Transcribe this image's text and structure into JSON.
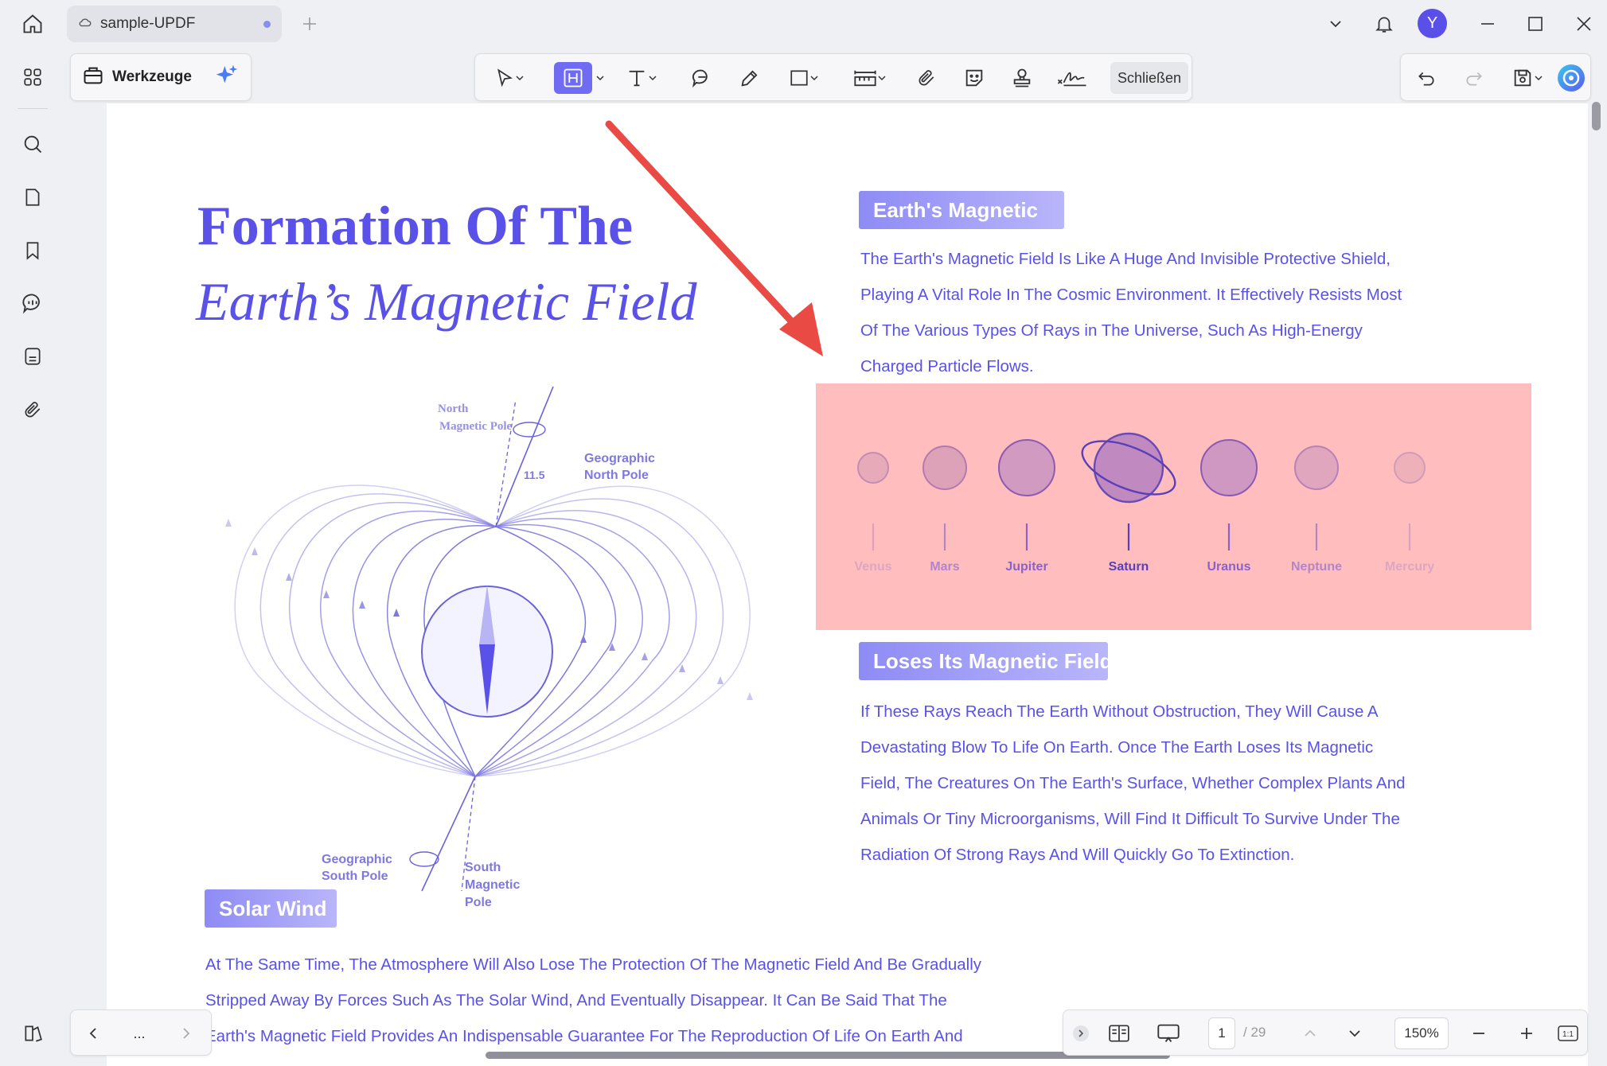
{
  "tab": {
    "title": "sample-UPDF"
  },
  "user": {
    "initial": "Y"
  },
  "toolbar": {
    "tools_label": "Werkzeuge",
    "close_label": "Schließen"
  },
  "document": {
    "title_line1": "Formation Of The",
    "title_line2": "Earth’s Magnetic Field",
    "section1": {
      "heading": "Earth's Magnetic",
      "lines": [
        "The Earth's Magnetic Field Is Like A Huge And Invisible Protective Shield,",
        "Playing A Vital Role In The Cosmic Environment. It Effectively Resists Most",
        "Of The Various Types Of Rays in The Universe, Such As High-Energy",
        "Charged Particle Flows."
      ]
    },
    "section2": {
      "heading": "Loses Its Magnetic Field",
      "lines": [
        "If These Rays Reach The Earth Without Obstruction, They Will Cause A",
        "Devastating Blow To Life On Earth. Once The Earth Loses Its Magnetic",
        "Field, The Creatures On The Earth's Surface, Whether Complex Plants And",
        "Animals Or Tiny Microorganisms, Will Find It Difficult To Survive Under The",
        "Radiation Of Strong Rays And Will Quickly Go To Extinction."
      ]
    },
    "section3": {
      "heading": "Solar Wind",
      "lines": [
        "At The Same Time, The Atmosphere Will Also Lose The Protection Of The Magnetic Field And Be Gradually",
        "Stripped Away By Forces Such As The Solar Wind, And Eventually Disappear. It Can Be Said That The",
        "Earth's Magnetic Field Provides An Indispensable Guarantee For The Reproduction Of Life On Earth And"
      ]
    },
    "diagram": {
      "north_magnetic": [
        "North",
        "Magnetic Pole"
      ],
      "geo_north": [
        "Geographic",
        "North Pole"
      ],
      "geo_south": [
        "Geographic",
        "South Pole"
      ],
      "south_magnetic": [
        "South",
        "Magnetic",
        "Pole"
      ],
      "angle": "11.5"
    },
    "planets": [
      "Venus",
      "Mars",
      "Jupiter",
      "Saturn",
      "Uranus",
      "Neptune",
      "Mercury"
    ]
  },
  "pagination": {
    "current": "1",
    "total": "/ 29",
    "zoom": "150%",
    "more": "..."
  },
  "colors": {
    "accent": "#6f6cf3",
    "doc_text": "#5a52e8",
    "highlight": "#ffbdbd",
    "arrow": "#ea4a44"
  }
}
